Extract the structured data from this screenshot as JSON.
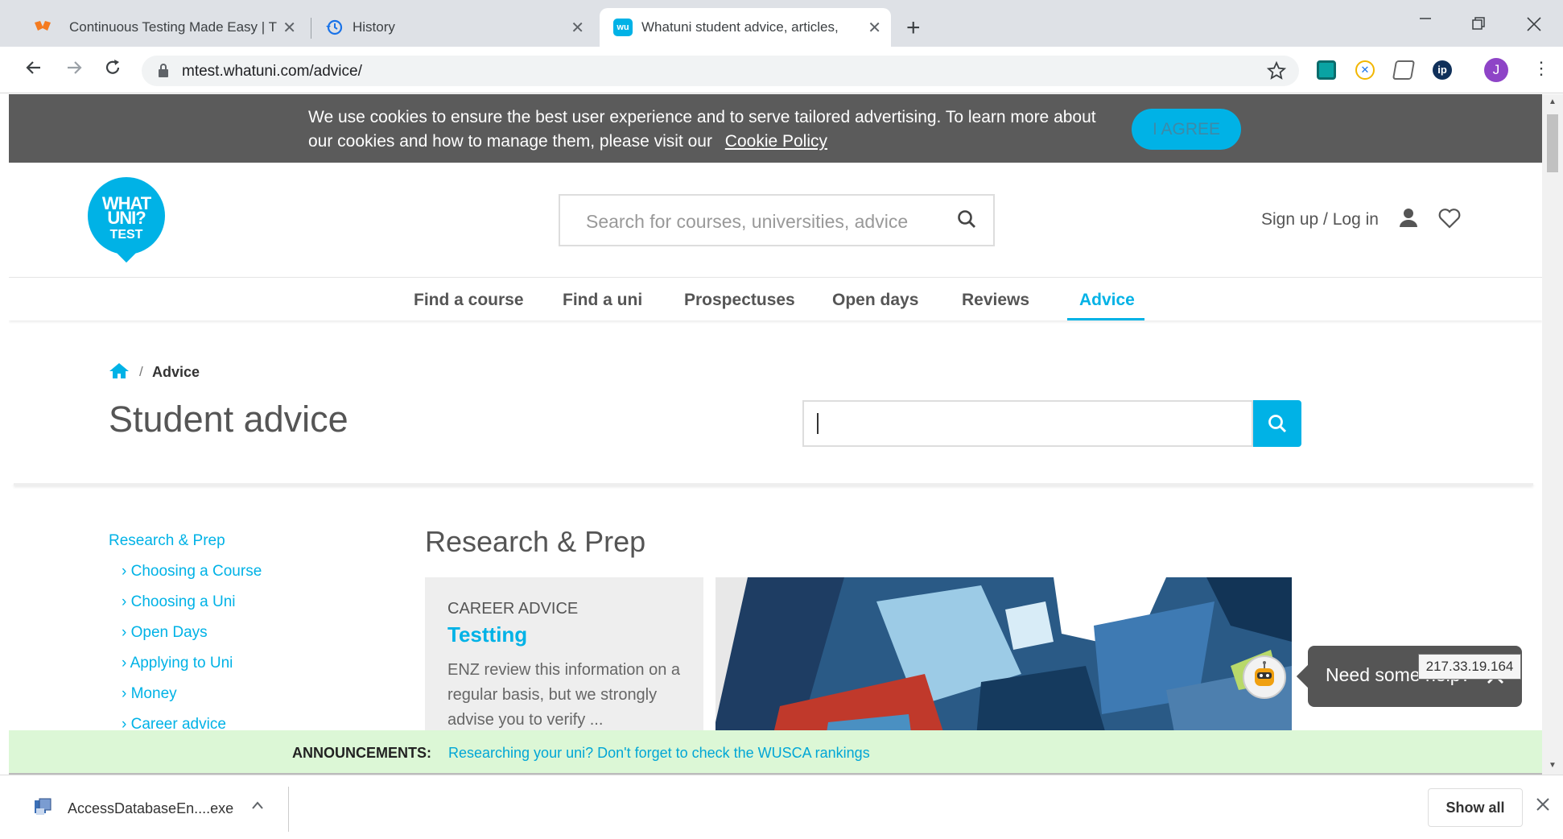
{
  "browser": {
    "tabs": [
      {
        "title": "Continuous Testing Made Easy | T",
        "icon": "orange-logo-icon",
        "active": false
      },
      {
        "title": "History",
        "icon": "history-icon",
        "active": false
      },
      {
        "title": "Whatuni student advice, articles,",
        "icon": "whatuni-favicon-icon",
        "active": true
      }
    ],
    "new_tab": "+",
    "url": "mtest.whatuni.com/advice/",
    "profile_initial": "J",
    "window_controls": [
      "minimize",
      "restore",
      "close"
    ]
  },
  "cookie_banner": {
    "text": "We use cookies to ensure the best user experience and to serve tailored advertising. To learn more about our cookies and how to manage them, please visit our",
    "link": "Cookie Policy",
    "button": "I AGREE"
  },
  "header": {
    "logo_line1": "WHAT",
    "logo_line2": "UNI?",
    "logo_line3": "TEST",
    "search_placeholder": "Search for courses, universities, advice",
    "signin": "Sign up / Log in"
  },
  "nav": {
    "items": [
      "Find a course",
      "Find a uni",
      "Prospectuses",
      "Open days",
      "Reviews",
      "Advice"
    ],
    "active": "Advice"
  },
  "breadcrumb": {
    "separator": "/",
    "current": "Advice"
  },
  "page_title": "Student advice",
  "sidebar": {
    "heading": "Research & Prep",
    "items": [
      "Choosing a Course",
      "Choosing a Uni",
      "Open Days",
      "Applying to Uni",
      "Money",
      "Career advice"
    ]
  },
  "section": {
    "title": "Research & Prep",
    "card": {
      "category": "CAREER ADVICE",
      "title": "Testting",
      "description": "ENZ review this information on a regular basis, but we strongly advise you to verify ..."
    }
  },
  "help_widget": {
    "text": "Need some help?"
  },
  "announcements": {
    "label": "ANNOUNCEMENTS:",
    "link": "Researching your uni? Don't forget to check the WUSCA rankings"
  },
  "ip_badge": "217.33.19.164",
  "download_bar": {
    "file": "AccessDatabaseEn....exe",
    "show_all": "Show all"
  },
  "colors": {
    "accent": "#00b2e6",
    "cookie_bg": "#5b5b5b",
    "announce_bg": "#dcf7d6"
  }
}
